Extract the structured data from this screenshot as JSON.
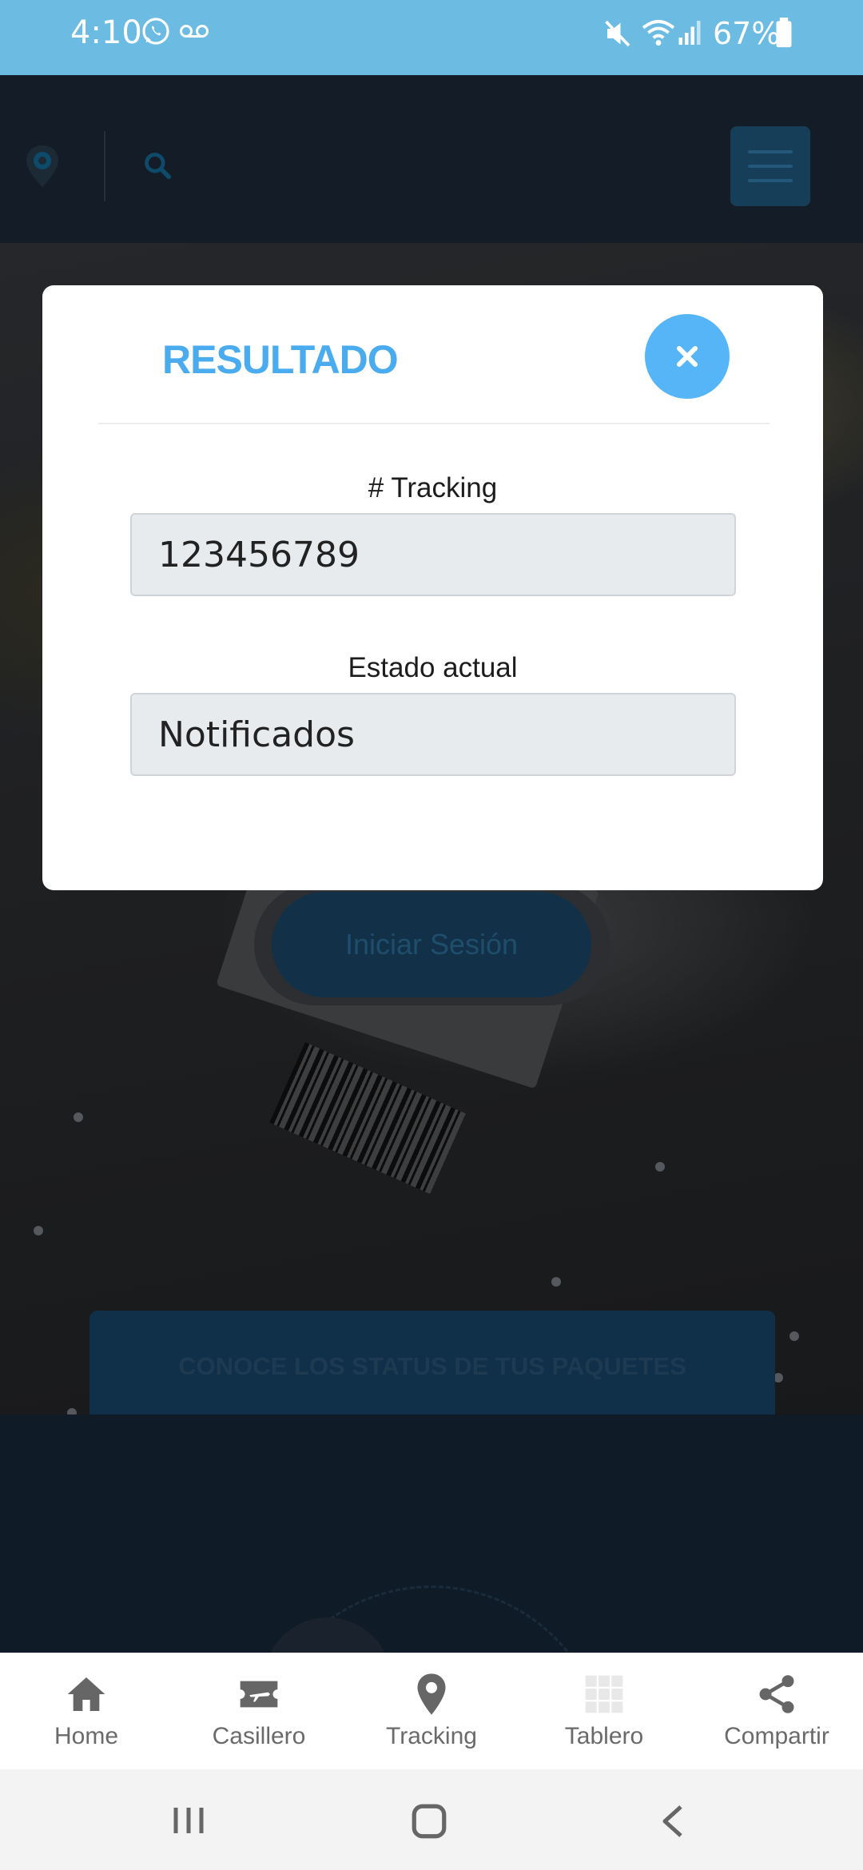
{
  "status_bar": {
    "time": "4:10",
    "battery": "67%"
  },
  "hero": {
    "login_label": "Iniciar Sesión",
    "status_card_title": "CONOCE LOS STATUS DE TUS PAQUETES"
  },
  "modal": {
    "title": "RESULTADO",
    "close_icon": "close-x-icon",
    "tracking_label": "# Tracking",
    "tracking_value": "123456789",
    "estado_label": "Estado actual",
    "estado_value": "Notificados"
  },
  "bottom_nav": {
    "items": [
      {
        "label": "Home",
        "icon": "home-icon"
      },
      {
        "label": "Casillero",
        "icon": "ticket-plane-icon"
      },
      {
        "label": "Tracking",
        "icon": "map-pin-icon"
      },
      {
        "label": "Tablero",
        "icon": "grid-icon"
      },
      {
        "label": "Compartir",
        "icon": "share-icon"
      }
    ]
  },
  "colors": {
    "accent": "#55b5f6",
    "title": "#4aacef",
    "status_bar": "#6bbbe3"
  }
}
